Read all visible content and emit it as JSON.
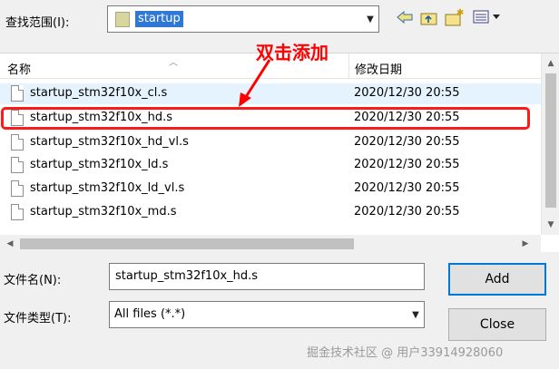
{
  "look_in": {
    "label": "查找范围(I):",
    "value": "startup"
  },
  "toolbar": {
    "back_icon": "back-arrow-icon",
    "up_icon": "up-folder-icon",
    "new_folder_icon": "new-folder-icon",
    "view_icon": "view-menu-icon"
  },
  "list": {
    "columns": {
      "name": "名称",
      "date": "修改日期"
    },
    "rows": [
      {
        "name": "startup_stm32f10x_cl.s",
        "date": "2020/12/30 20:55"
      },
      {
        "name": "startup_stm32f10x_hd.s",
        "date": "2020/12/30 20:55"
      },
      {
        "name": "startup_stm32f10x_hd_vl.s",
        "date": "2020/12/30 20:55"
      },
      {
        "name": "startup_stm32f10x_ld.s",
        "date": "2020/12/30 20:55"
      },
      {
        "name": "startup_stm32f10x_ld_vl.s",
        "date": "2020/12/30 20:55"
      },
      {
        "name": "startup_stm32f10x_md.s",
        "date": "2020/12/30 20:55"
      }
    ]
  },
  "annotation": "双击添加",
  "file_name": {
    "label": "文件名(N):",
    "value": "startup_stm32f10x_hd.s"
  },
  "file_type": {
    "label": "文件类型(T):",
    "value": "All files (*.*)"
  },
  "buttons": {
    "add": "Add",
    "close": "Close"
  },
  "watermark": {
    "text1": "掘金技术社区 @ 用户3391492806",
    "text2": "0"
  }
}
